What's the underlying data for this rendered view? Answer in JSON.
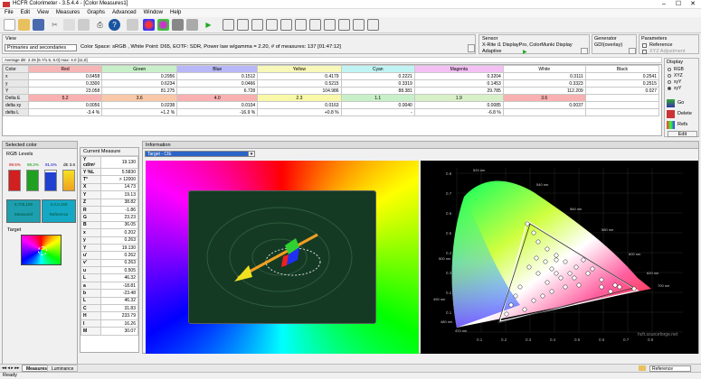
{
  "window": {
    "title": "HCFR Colorimeter - 3.5.4.4 - [Color Measures1]",
    "min": "–",
    "max": "☐",
    "close": "✕"
  },
  "menu": [
    "File",
    "Edit",
    "View",
    "Measures",
    "Graphs",
    "Advanced",
    "Window",
    "Help"
  ],
  "view": {
    "label": "View",
    "dropdown": "Primaries and secondaries",
    "info": "Color Space: sRGB , White Point: D65, EOTF:  SDR, Power law w/gamma = 2.20, # of measures: 137 [01:47:12]"
  },
  "sensor": {
    "label": "Sensor",
    "device": "X-Rite i1 DisplayPro, ColorMunki Display",
    "mode": "Adaptive"
  },
  "generator": {
    "label": "Generator",
    "value": "GDI(overlay)"
  },
  "parameters": {
    "label": "Parameters",
    "reference": "Reference",
    "adjust": "XYZ Adjustment"
  },
  "average": "Average dE: 2.25 [6.7/1.5, 6.0] max: 4.0 [11,0]",
  "grid": {
    "columns": [
      "Color",
      "Red",
      "Green",
      "Blue",
      "Yellow",
      "Cyan",
      "Magenta",
      "White",
      "Black"
    ],
    "col_colors": [
      "#e8e8e8",
      "#f7b6b6",
      "#c8f0c8",
      "#b8b8f8",
      "#f8f8b8",
      "#c0f4f4",
      "#f4c0f4",
      "#ffffff",
      "#ffffff"
    ],
    "rows": [
      {
        "name": "x",
        "cells": [
          "0.6458",
          "0.2956",
          "0.1512",
          "0.4179",
          "0.2221",
          "0.3204",
          "0.3111",
          "0.2541"
        ]
      },
      {
        "name": "y",
        "cells": [
          "0.3300",
          "0.6234",
          "0.0466",
          "0.5215",
          "0.3319",
          "0.1453",
          "0.3323",
          "0.2515"
        ]
      },
      {
        "name": "Y",
        "cells": [
          "23.058",
          "81.275",
          "6.728",
          "104.986",
          "88.381",
          "29.785",
          "112.209",
          "0.027"
        ]
      },
      {
        "name": "Delta E",
        "cells": [
          "5.2",
          "3.6",
          "4.0",
          "2.3",
          "1.1",
          "1.9",
          "3.6",
          ""
        ]
      },
      {
        "name": "delta xy",
        "cells": [
          "0.0056",
          "0.0238",
          "0.0104",
          "0.0163",
          "0.0040",
          "0.0085",
          "0.0037",
          ""
        ]
      },
      {
        "name": "delta L",
        "cells": [
          "-3.4 %",
          "+1.2 %",
          "-16.9 %",
          "+0.8 %",
          "-",
          "-6.8 %",
          "",
          ""
        ]
      }
    ],
    "delta_colors": [
      "#f8b0b0",
      "#f8c8a8",
      "#f8b0b0",
      "#f8f8a8",
      "#c8f0c8",
      "#d8f0c8",
      "#f8b0b0",
      ""
    ]
  },
  "display": {
    "label": "Display",
    "options": [
      "RGB",
      "XYZ",
      "xyY",
      "xyY"
    ],
    "selected": 3
  },
  "actions": {
    "go": "Go",
    "delete": "Delete",
    "refs": "Refs",
    "edit": "Edit"
  },
  "selected": {
    "label": "Selected color",
    "rgb_levels": "RGB Levels",
    "bars": [
      {
        "pct": "99.6%",
        "fill": 0.996
      },
      {
        "pct": "98.2%",
        "fill": 0.982
      },
      {
        "pct": "91.5%",
        "fill": 0.915
      }
    ],
    "de": "dE 3.6",
    "measured_label": "Measured",
    "measured_val": "8,725,159",
    "reference_label": "Reference",
    "reference_val": "0,0,0,159",
    "target": "Target"
  },
  "current_measure": {
    "label": "Current Measure",
    "rows": [
      [
        "Y cd/m²",
        "19.130"
      ],
      [
        "Y %L",
        "5.5830"
      ],
      [
        "T°",
        "> 12000"
      ],
      [
        "X",
        "14.73"
      ],
      [
        "Y",
        "19.13"
      ],
      [
        "Z",
        "38.82"
      ],
      [
        "R",
        "-1.86"
      ],
      [
        "G",
        "23.23"
      ],
      [
        "B",
        "36.05"
      ],
      [
        "x",
        "0.202"
      ],
      [
        "y",
        "0.263"
      ],
      [
        "Y",
        "19.130"
      ],
      [
        "u'",
        "0.262"
      ],
      [
        "v'",
        "0.263"
      ],
      [
        "u",
        "0.505"
      ],
      [
        "L",
        "46.32"
      ],
      [
        "a",
        "-18.81"
      ],
      [
        "b",
        "-23.48"
      ],
      [
        "L",
        "46.32"
      ],
      [
        "C",
        "31.83"
      ],
      [
        "H",
        "233.79"
      ],
      [
        "I",
        "16.26"
      ],
      [
        "M",
        "30.07"
      ]
    ]
  },
  "information": {
    "label": "Information",
    "target": "Target - CIE"
  },
  "cie": {
    "xticks": [
      "0.1",
      "0.2",
      "0.3",
      "0.4",
      "0.5",
      "0.6",
      "0.7",
      "0.8"
    ],
    "yticks": [
      "0.1",
      "0.2",
      "0.3",
      "0.4",
      "0.5",
      "0.6",
      "0.7",
      "0.8"
    ],
    "wl": [
      "520 nm",
      "540 nm",
      "560 nm",
      "580 nm",
      "600 nm",
      "620 nm",
      "700 nm",
      "500 nm",
      "490 nm",
      "480 nm",
      "470 nm"
    ],
    "credit": "hcfr.sourceforge.net"
  },
  "tabs": [
    "Measures",
    "Luminance"
  ],
  "tab_right": "Reference",
  "statusbar": "Ready"
}
